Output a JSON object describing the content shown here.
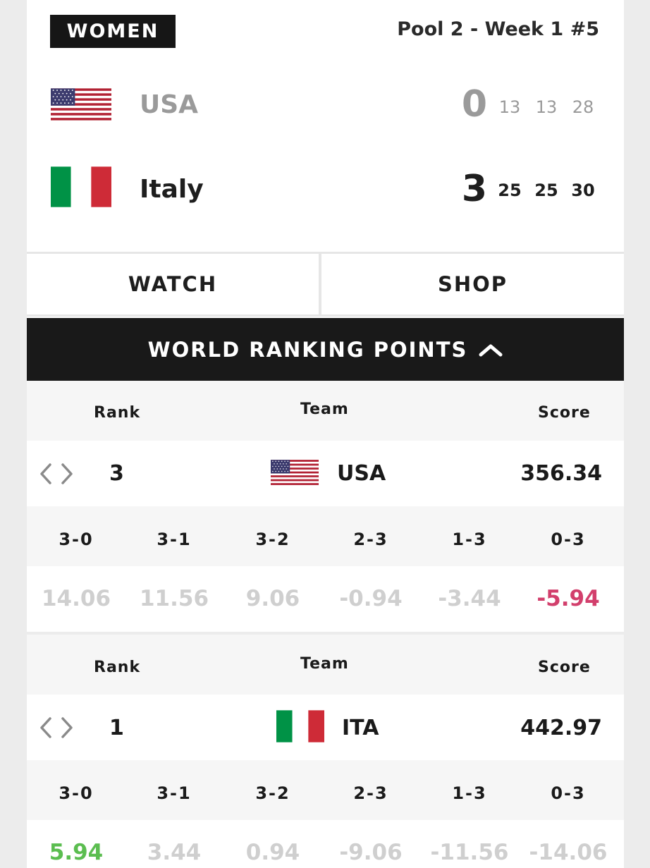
{
  "header": {
    "category": "WOMEN",
    "pool": "Pool 2 - Week 1 #5"
  },
  "match": {
    "teams": [
      {
        "name": "USA",
        "sets_won": "0",
        "set_scores": [
          "13",
          "13",
          "28"
        ],
        "flag_icon": "usa-flag-icon"
      },
      {
        "name": "Italy",
        "sets_won": "3",
        "set_scores": [
          "25",
          "25",
          "30"
        ],
        "flag_icon": "italy-flag-icon"
      }
    ]
  },
  "actions": {
    "watch_label": "WATCH",
    "shop_label": "SHOP"
  },
  "wrp": {
    "title": "WORLD RANKING POINTS",
    "toggle_icon": "chevron-up-icon",
    "columns": {
      "rank": "Rank",
      "team": "Team",
      "score": "Score"
    },
    "results_header": [
      "3-0",
      "3-1",
      "3-2",
      "2-3",
      "1-3",
      "0-3"
    ],
    "entries": [
      {
        "rank": "3",
        "code": "USA",
        "score": "356.34",
        "points": [
          "14.06",
          "11.56",
          "9.06",
          "-0.94",
          "-3.44",
          "-5.94"
        ],
        "highlight_index": 5,
        "highlight_color": "#d23f6c"
      },
      {
        "rank": "1",
        "code": "ITA",
        "score": "442.97",
        "points": [
          "5.94",
          "3.44",
          "0.94",
          "-9.06",
          "-11.56",
          "-14.06"
        ],
        "highlight_index": 0,
        "highlight_color": "#5bbd50"
      }
    ]
  },
  "colors": {
    "dark": "#161616",
    "muted_points": "#cfcfcf",
    "loss_highlight": "#d23f6c",
    "win_highlight": "#5bbd50"
  }
}
